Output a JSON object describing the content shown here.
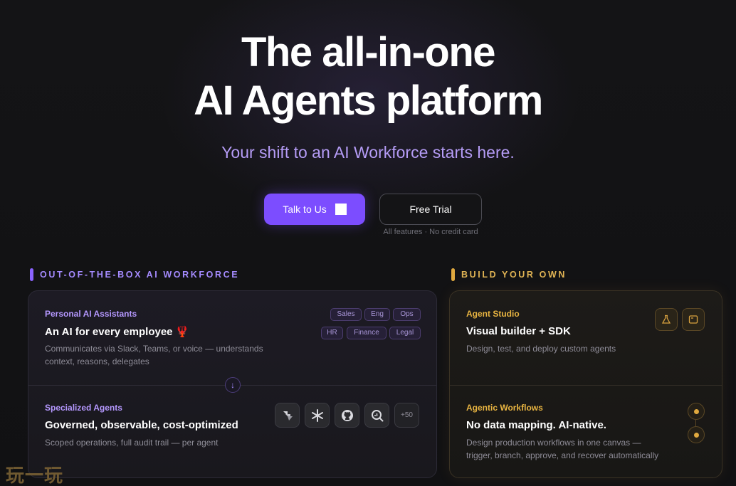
{
  "hero": {
    "title_line1": "The all-in-one",
    "title_line2": "AI Agents platform",
    "subtitle": "Your shift to an AI Workforce starts here."
  },
  "cta": {
    "primary_label": "Talk to Us",
    "secondary_label": "Free Trial",
    "note": "All features · No credit card"
  },
  "sections": {
    "left_label": "OUT-OF-THE-BOX AI WORKFORCE",
    "right_label": "BUILD YOUR OWN"
  },
  "workforce_card": {
    "personal": {
      "kicker": "Personal AI Assistants",
      "title": "An AI for every employee 🦞",
      "description_line1": "Communicates via Slack, Teams, or voice — understands",
      "description_line2": "context, reasons, delegates",
      "tags": [
        "Sales",
        "Eng",
        "Ops",
        "HR",
        "Finance",
        "Legal"
      ]
    },
    "specialized": {
      "kicker": "Specialized Agents",
      "title": "Governed, observable, cost-optimized",
      "description": "Scoped operations, full audit trail — per agent",
      "integrations": [
        "jira-logo-icon",
        "snowflake-logo-icon",
        "github-logo-icon",
        "search-analytics-logo-icon"
      ],
      "more_count": "+50"
    }
  },
  "build_card": {
    "studio": {
      "kicker": "Agent Studio",
      "title": "Visual builder + SDK",
      "description": "Design, test, and deploy custom agents",
      "icons": [
        "flask-icon",
        "window-icon"
      ]
    },
    "workflows": {
      "kicker": "Agentic Workflows",
      "title": "No data mapping. AI-native.",
      "description_line1": "Design production workflows in one canvas —",
      "description_line2": "trigger, branch, approve, and recover automatically"
    }
  },
  "watermark": "玩一玩",
  "colors": {
    "accent_purple": "#7c4dff",
    "label_purple": "#a58bff",
    "accent_gold": "#e0a93f",
    "background": "#121214"
  }
}
